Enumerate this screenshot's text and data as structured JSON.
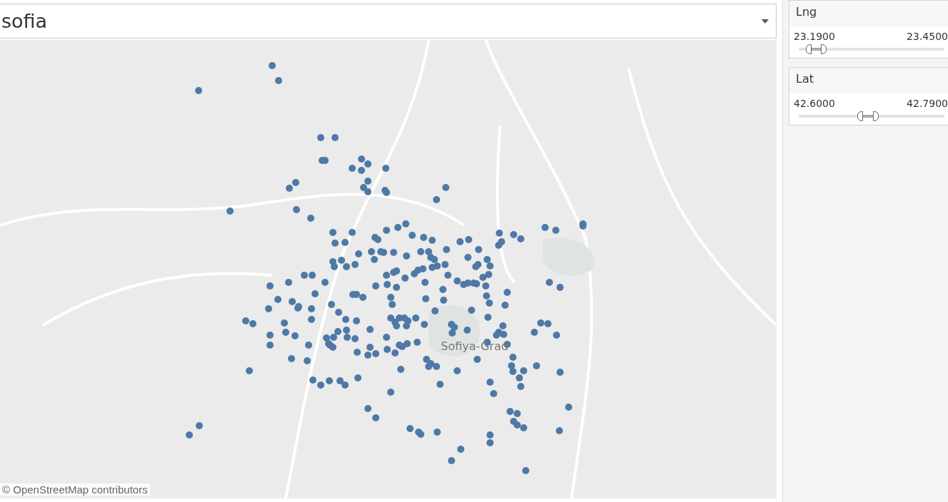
{
  "dropdown": {
    "value": "sofia"
  },
  "map": {
    "place_label": "Sofiya-Grad",
    "attribution": "© OpenStreetMap contributors"
  },
  "filters": [
    {
      "title": "Lng",
      "min_label": "23.1900",
      "max_label": "23.4500",
      "thumbs": [
        {
          "level": 0.07
        },
        {
          "level": 0.17
        }
      ]
    },
    {
      "title": "Lat",
      "min_label": "42.6000",
      "max_label": "42.7900",
      "thumbs": [
        {
          "level": 0.42
        },
        {
          "level": 0.53
        }
      ]
    }
  ]
}
